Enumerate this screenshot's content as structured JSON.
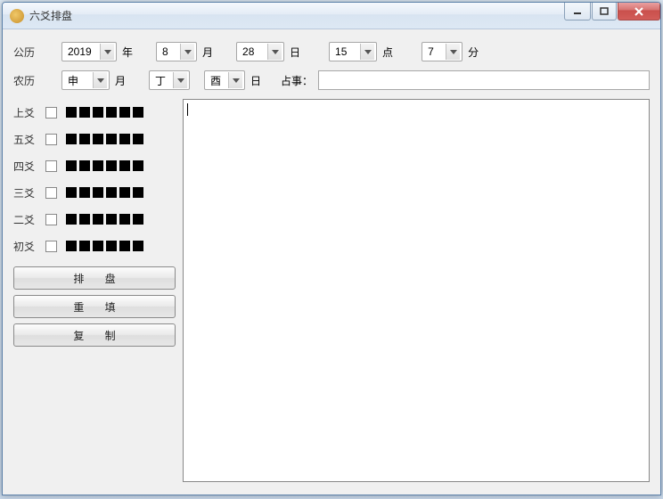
{
  "window": {
    "title": "六爻排盘"
  },
  "solar": {
    "label": "公历",
    "year": "2019",
    "year_unit": "年",
    "month": "8",
    "month_unit": "月",
    "day": "28",
    "day_unit": "日",
    "hour": "15",
    "hour_unit": "点",
    "minute": "7",
    "minute_unit": "分"
  },
  "lunar": {
    "label": "农历",
    "month": "申",
    "month_unit": "月",
    "day_stem": "丁",
    "day_branch": "酉",
    "day_unit": "日",
    "topic_label": "占事：",
    "topic_value": ""
  },
  "yao": {
    "rows": [
      {
        "label": "上爻"
      },
      {
        "label": "五爻"
      },
      {
        "label": "四爻"
      },
      {
        "label": "三爻"
      },
      {
        "label": "二爻"
      },
      {
        "label": "初爻"
      }
    ]
  },
  "buttons": {
    "paipan": "排 盘",
    "refill": "重 填",
    "copy": "复 制"
  },
  "output_text": ""
}
